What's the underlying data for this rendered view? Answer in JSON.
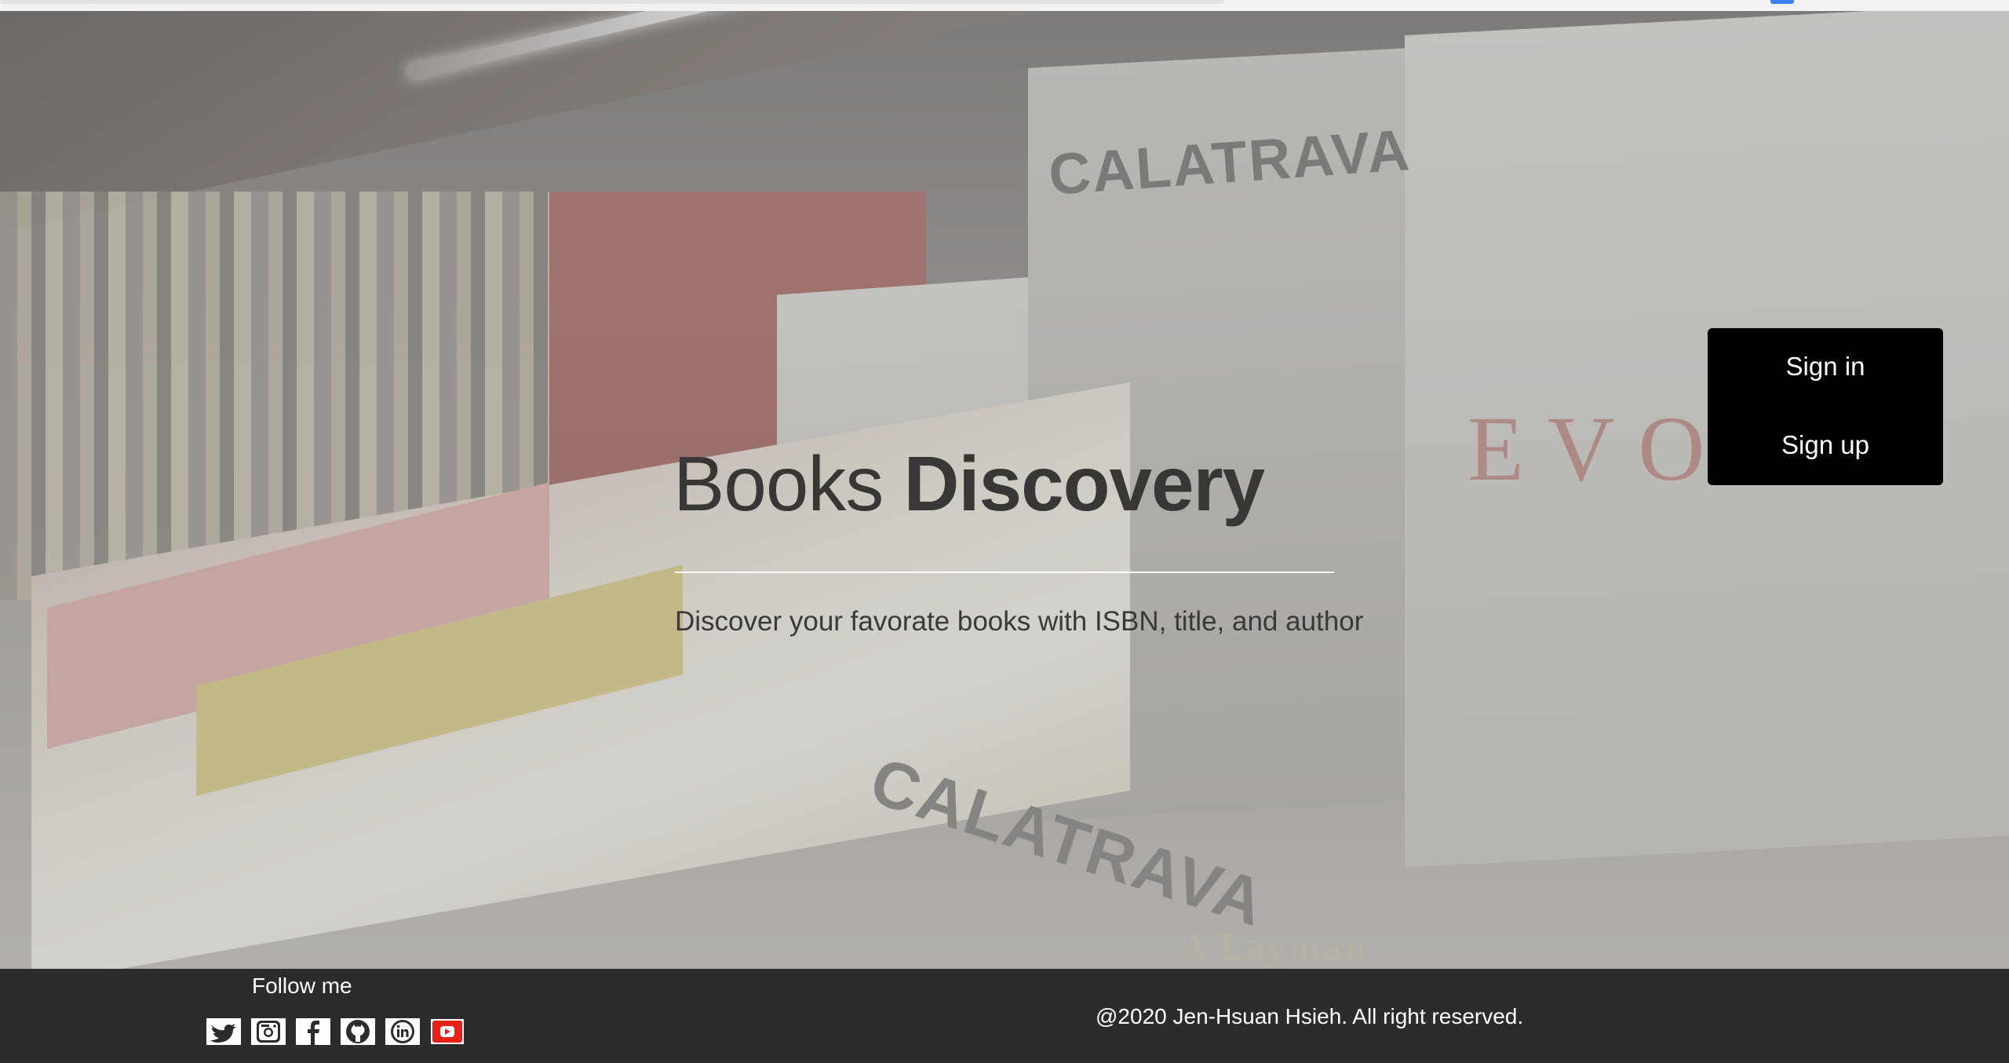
{
  "hero": {
    "title_light": "Books",
    "title_bold": "Discovery",
    "subtitle": "Discover your favorate books with ISBN, title, and author",
    "background_text": {
      "calatrava_top": "CALATRAVA",
      "calatrava_bottom": "CALATRAVA",
      "evol": "EVOL",
      "layman": "A Layman"
    }
  },
  "auth": {
    "sign_in_label": "Sign in",
    "sign_up_label": "Sign up"
  },
  "footer": {
    "follow_label": "Follow me",
    "social_icons": [
      "twitter-icon",
      "instagram-icon",
      "facebook-icon",
      "github-icon",
      "linkedin-icon",
      "youtube-icon"
    ],
    "copyright": "@2020 Jen-Hsuan Hsieh. All right reserved."
  },
  "colors": {
    "footer_bg": "#2c2c2c",
    "auth_bg": "#000000",
    "youtube_red": "#e62117",
    "title_text": "#383735"
  }
}
